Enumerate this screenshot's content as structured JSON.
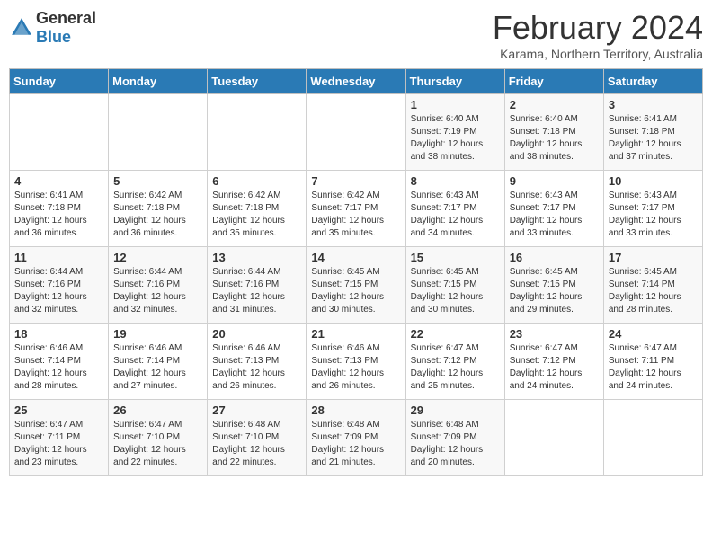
{
  "logo": {
    "general": "General",
    "blue": "Blue"
  },
  "title": "February 2024",
  "subtitle": "Karama, Northern Territory, Australia",
  "days_of_week": [
    "Sunday",
    "Monday",
    "Tuesday",
    "Wednesday",
    "Thursday",
    "Friday",
    "Saturday"
  ],
  "weeks": [
    [
      {
        "day": "",
        "sunrise": "",
        "sunset": "",
        "daylight": ""
      },
      {
        "day": "",
        "sunrise": "",
        "sunset": "",
        "daylight": ""
      },
      {
        "day": "",
        "sunrise": "",
        "sunset": "",
        "daylight": ""
      },
      {
        "day": "",
        "sunrise": "",
        "sunset": "",
        "daylight": ""
      },
      {
        "day": "1",
        "sunrise": "Sunrise: 6:40 AM",
        "sunset": "Sunset: 7:19 PM",
        "daylight": "Daylight: 12 hours and 38 minutes."
      },
      {
        "day": "2",
        "sunrise": "Sunrise: 6:40 AM",
        "sunset": "Sunset: 7:18 PM",
        "daylight": "Daylight: 12 hours and 38 minutes."
      },
      {
        "day": "3",
        "sunrise": "Sunrise: 6:41 AM",
        "sunset": "Sunset: 7:18 PM",
        "daylight": "Daylight: 12 hours and 37 minutes."
      }
    ],
    [
      {
        "day": "4",
        "sunrise": "Sunrise: 6:41 AM",
        "sunset": "Sunset: 7:18 PM",
        "daylight": "Daylight: 12 hours and 36 minutes."
      },
      {
        "day": "5",
        "sunrise": "Sunrise: 6:42 AM",
        "sunset": "Sunset: 7:18 PM",
        "daylight": "Daylight: 12 hours and 36 minutes."
      },
      {
        "day": "6",
        "sunrise": "Sunrise: 6:42 AM",
        "sunset": "Sunset: 7:18 PM",
        "daylight": "Daylight: 12 hours and 35 minutes."
      },
      {
        "day": "7",
        "sunrise": "Sunrise: 6:42 AM",
        "sunset": "Sunset: 7:17 PM",
        "daylight": "Daylight: 12 hours and 35 minutes."
      },
      {
        "day": "8",
        "sunrise": "Sunrise: 6:43 AM",
        "sunset": "Sunset: 7:17 PM",
        "daylight": "Daylight: 12 hours and 34 minutes."
      },
      {
        "day": "9",
        "sunrise": "Sunrise: 6:43 AM",
        "sunset": "Sunset: 7:17 PM",
        "daylight": "Daylight: 12 hours and 33 minutes."
      },
      {
        "day": "10",
        "sunrise": "Sunrise: 6:43 AM",
        "sunset": "Sunset: 7:17 PM",
        "daylight": "Daylight: 12 hours and 33 minutes."
      }
    ],
    [
      {
        "day": "11",
        "sunrise": "Sunrise: 6:44 AM",
        "sunset": "Sunset: 7:16 PM",
        "daylight": "Daylight: 12 hours and 32 minutes."
      },
      {
        "day": "12",
        "sunrise": "Sunrise: 6:44 AM",
        "sunset": "Sunset: 7:16 PM",
        "daylight": "Daylight: 12 hours and 32 minutes."
      },
      {
        "day": "13",
        "sunrise": "Sunrise: 6:44 AM",
        "sunset": "Sunset: 7:16 PM",
        "daylight": "Daylight: 12 hours and 31 minutes."
      },
      {
        "day": "14",
        "sunrise": "Sunrise: 6:45 AM",
        "sunset": "Sunset: 7:15 PM",
        "daylight": "Daylight: 12 hours and 30 minutes."
      },
      {
        "day": "15",
        "sunrise": "Sunrise: 6:45 AM",
        "sunset": "Sunset: 7:15 PM",
        "daylight": "Daylight: 12 hours and 30 minutes."
      },
      {
        "day": "16",
        "sunrise": "Sunrise: 6:45 AM",
        "sunset": "Sunset: 7:15 PM",
        "daylight": "Daylight: 12 hours and 29 minutes."
      },
      {
        "day": "17",
        "sunrise": "Sunrise: 6:45 AM",
        "sunset": "Sunset: 7:14 PM",
        "daylight": "Daylight: 12 hours and 28 minutes."
      }
    ],
    [
      {
        "day": "18",
        "sunrise": "Sunrise: 6:46 AM",
        "sunset": "Sunset: 7:14 PM",
        "daylight": "Daylight: 12 hours and 28 minutes."
      },
      {
        "day": "19",
        "sunrise": "Sunrise: 6:46 AM",
        "sunset": "Sunset: 7:14 PM",
        "daylight": "Daylight: 12 hours and 27 minutes."
      },
      {
        "day": "20",
        "sunrise": "Sunrise: 6:46 AM",
        "sunset": "Sunset: 7:13 PM",
        "daylight": "Daylight: 12 hours and 26 minutes."
      },
      {
        "day": "21",
        "sunrise": "Sunrise: 6:46 AM",
        "sunset": "Sunset: 7:13 PM",
        "daylight": "Daylight: 12 hours and 26 minutes."
      },
      {
        "day": "22",
        "sunrise": "Sunrise: 6:47 AM",
        "sunset": "Sunset: 7:12 PM",
        "daylight": "Daylight: 12 hours and 25 minutes."
      },
      {
        "day": "23",
        "sunrise": "Sunrise: 6:47 AM",
        "sunset": "Sunset: 7:12 PM",
        "daylight": "Daylight: 12 hours and 24 minutes."
      },
      {
        "day": "24",
        "sunrise": "Sunrise: 6:47 AM",
        "sunset": "Sunset: 7:11 PM",
        "daylight": "Daylight: 12 hours and 24 minutes."
      }
    ],
    [
      {
        "day": "25",
        "sunrise": "Sunrise: 6:47 AM",
        "sunset": "Sunset: 7:11 PM",
        "daylight": "Daylight: 12 hours and 23 minutes."
      },
      {
        "day": "26",
        "sunrise": "Sunrise: 6:47 AM",
        "sunset": "Sunset: 7:10 PM",
        "daylight": "Daylight: 12 hours and 22 minutes."
      },
      {
        "day": "27",
        "sunrise": "Sunrise: 6:48 AM",
        "sunset": "Sunset: 7:10 PM",
        "daylight": "Daylight: 12 hours and 22 minutes."
      },
      {
        "day": "28",
        "sunrise": "Sunrise: 6:48 AM",
        "sunset": "Sunset: 7:09 PM",
        "daylight": "Daylight: 12 hours and 21 minutes."
      },
      {
        "day": "29",
        "sunrise": "Sunrise: 6:48 AM",
        "sunset": "Sunset: 7:09 PM",
        "daylight": "Daylight: 12 hours and 20 minutes."
      },
      {
        "day": "",
        "sunrise": "",
        "sunset": "",
        "daylight": ""
      },
      {
        "day": "",
        "sunrise": "",
        "sunset": "",
        "daylight": ""
      }
    ]
  ]
}
